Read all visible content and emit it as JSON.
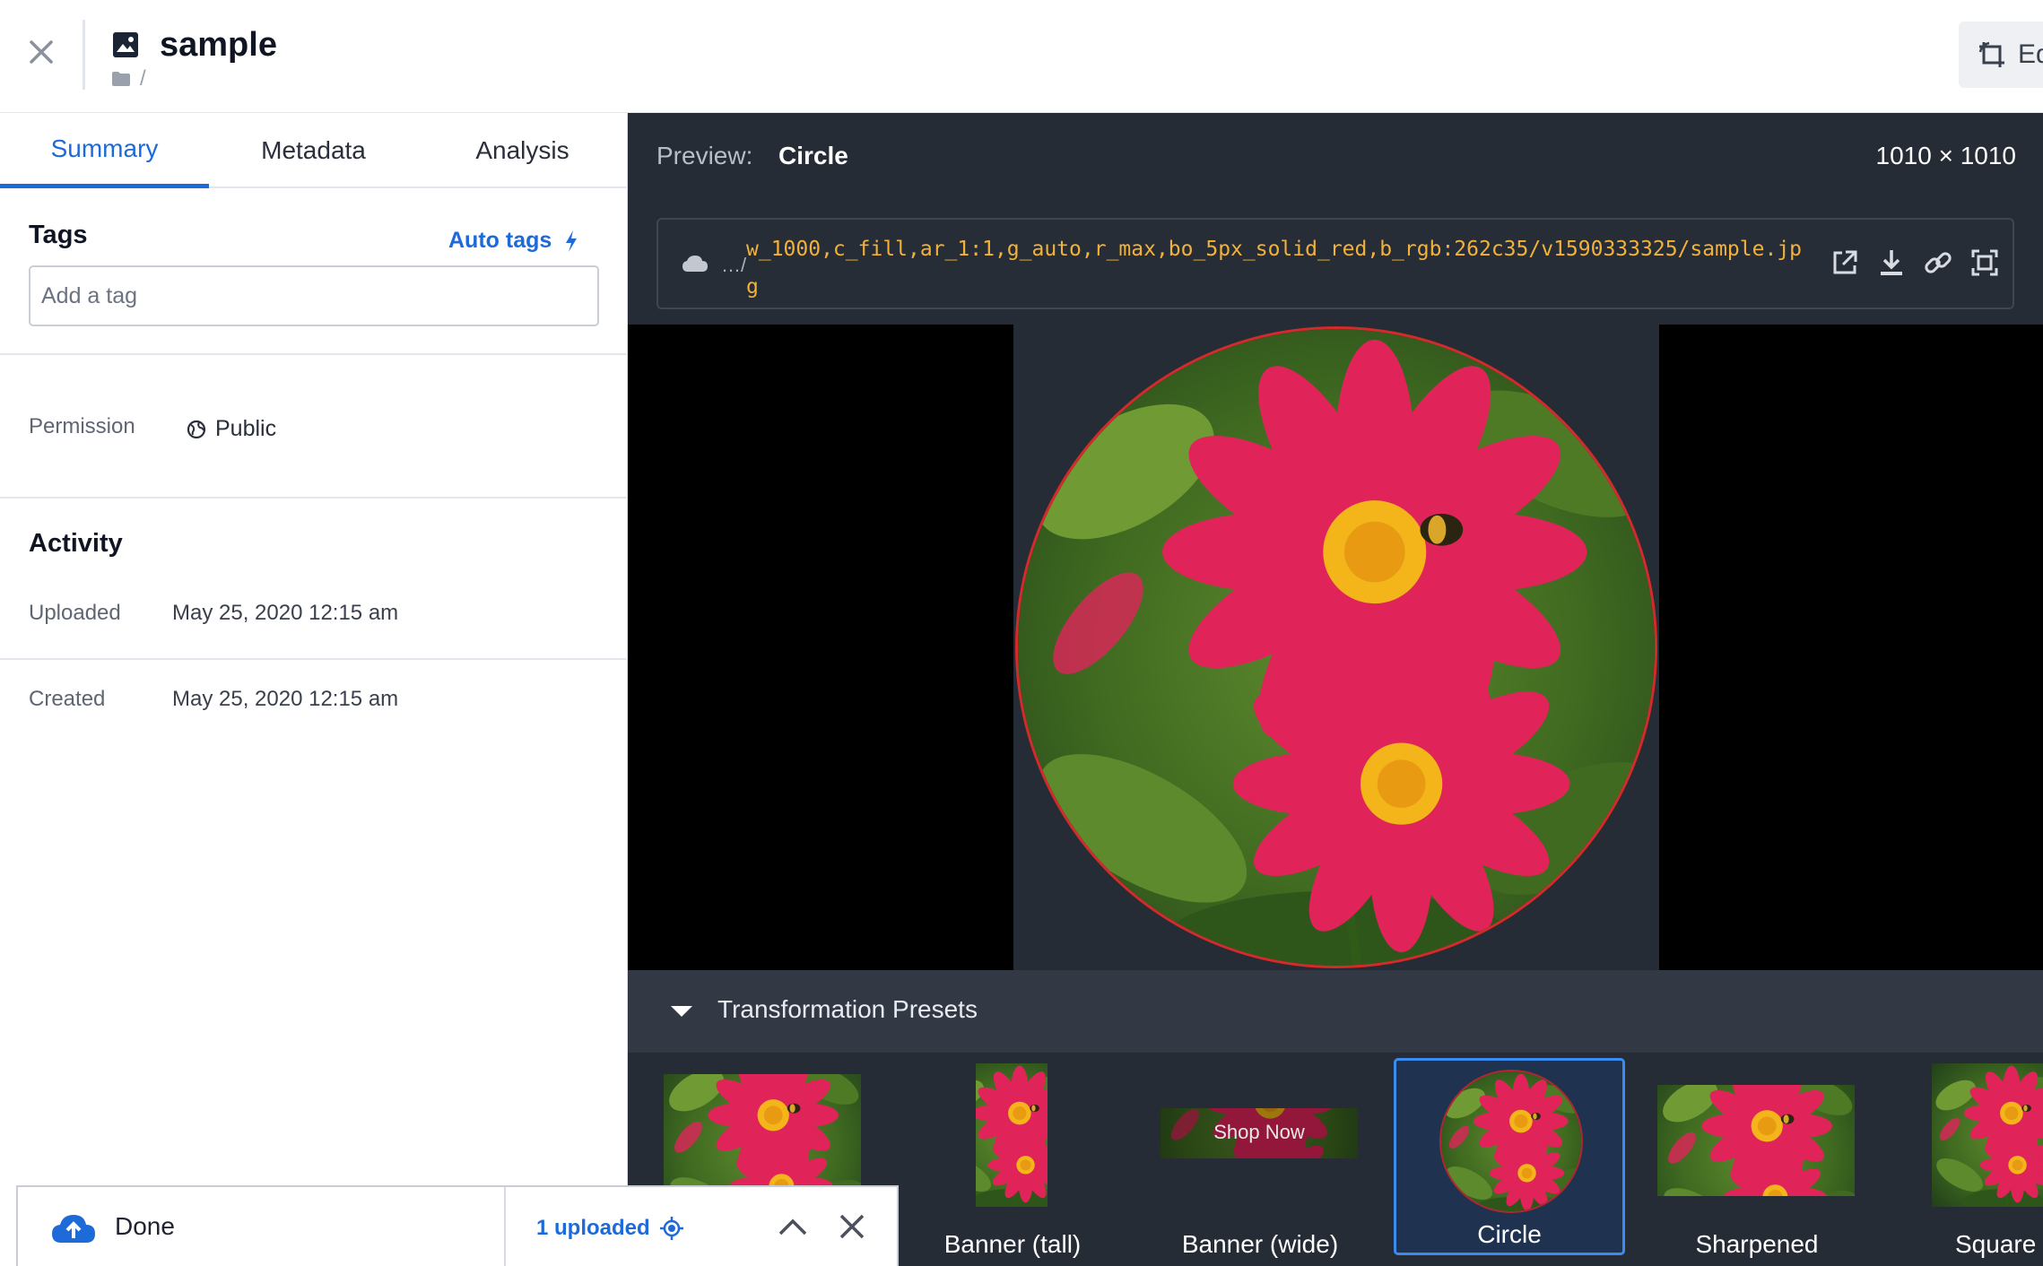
{
  "header": {
    "title": "sample",
    "path": "/",
    "edit_label": "Ed"
  },
  "tabs": [
    {
      "label": "Summary",
      "active": true
    },
    {
      "label": "Metadata",
      "active": false
    },
    {
      "label": "Analysis",
      "active": false
    }
  ],
  "tags": {
    "title": "Tags",
    "auto_tags_label": "Auto tags",
    "placeholder": "Add a tag"
  },
  "permission": {
    "label": "Permission",
    "value": "Public"
  },
  "activity": {
    "title": "Activity",
    "uploaded_label": "Uploaded",
    "uploaded_value": "May 25, 2020 12:15 am",
    "created_label": "Created",
    "created_value": "May 25, 2020 12:15 am"
  },
  "preview": {
    "label": "Preview:",
    "name": "Circle",
    "dimensions": "1010 × 1010",
    "url_prefix": "…/",
    "url": "w_1000,c_fill,ar_1:1,g_auto,r_max,bo_5px_solid_red,b_rgb:262c35/v1590333325/sample.jpg"
  },
  "presets": {
    "title": "Transformation Presets",
    "items": [
      {
        "label": "",
        "selected": false
      },
      {
        "label": "Banner (tall)",
        "selected": false
      },
      {
        "label": "Banner (wide)",
        "selected": false,
        "overlay_text": "Shop Now"
      },
      {
        "label": "Circle",
        "selected": true
      },
      {
        "label": "Sharpened",
        "selected": false
      },
      {
        "label": "Square",
        "selected": false
      }
    ]
  },
  "upload_toast": {
    "status": "Done",
    "count": "1 uploaded"
  },
  "colors": {
    "accent": "#1e6ad9",
    "dark_bg": "#262c35",
    "url_text": "#f2b23a",
    "border_red": "#d52a2a"
  }
}
